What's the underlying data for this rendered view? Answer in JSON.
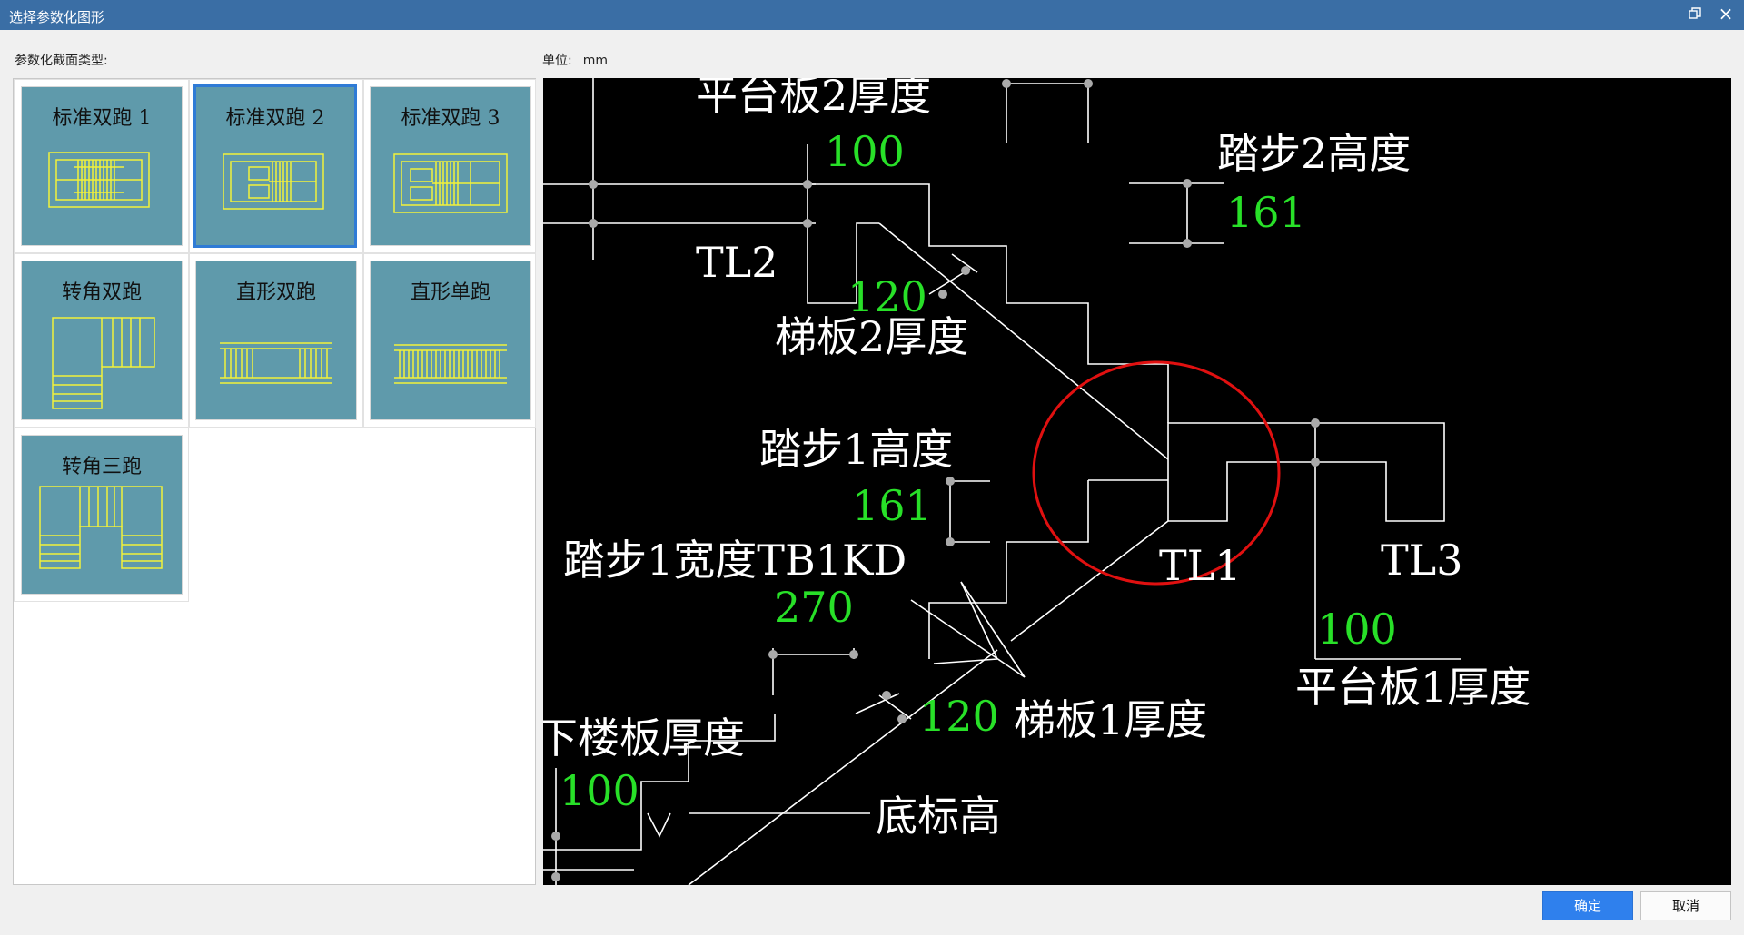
{
  "window": {
    "title": "选择参数化图形",
    "restore_icon": "restore-icon",
    "close_glyph": "×"
  },
  "left": {
    "section_label": "参数化截面类型:"
  },
  "unit": {
    "label": "单位:",
    "value": "mm"
  },
  "types": [
    {
      "label": "标准双跑 1",
      "selected": false
    },
    {
      "label": "标准双跑 2",
      "selected": true
    },
    {
      "label": "标准双跑 3",
      "selected": false
    },
    {
      "label": "转角双跑",
      "selected": false
    },
    {
      "label": "直形双跑",
      "selected": false
    },
    {
      "label": "直形单跑",
      "selected": false
    },
    {
      "label": "转角三跑",
      "selected": false
    }
  ],
  "drawing": {
    "labels": {
      "platform2": "平台板2厚度",
      "step2_height": "踏步2高度",
      "tl2": "TL2",
      "stair2_thickness": "梯板2厚度",
      "step1_height": "踏步1高度",
      "step1_width": "踏步1宽度TB1KD",
      "tl1": "TL1",
      "tl3": "TL3",
      "platform1": "平台板1厚度",
      "lower_slab": "下楼板厚度",
      "stair1_thickness": "梯板1厚度",
      "bottom_elev": "底标高"
    },
    "values": {
      "platform2": "100",
      "step2_height": "161",
      "stair2_thickness": "120",
      "step1_height": "161",
      "step1_width": "270",
      "platform1": "100",
      "stair1_thickness": "120",
      "lower_slab": "100"
    },
    "colors": {
      "background": "#000000",
      "lines": "#ffffff",
      "values": "#28e028",
      "highlight": "#e01010"
    }
  },
  "buttons": {
    "ok": "确定",
    "cancel": "取消"
  }
}
